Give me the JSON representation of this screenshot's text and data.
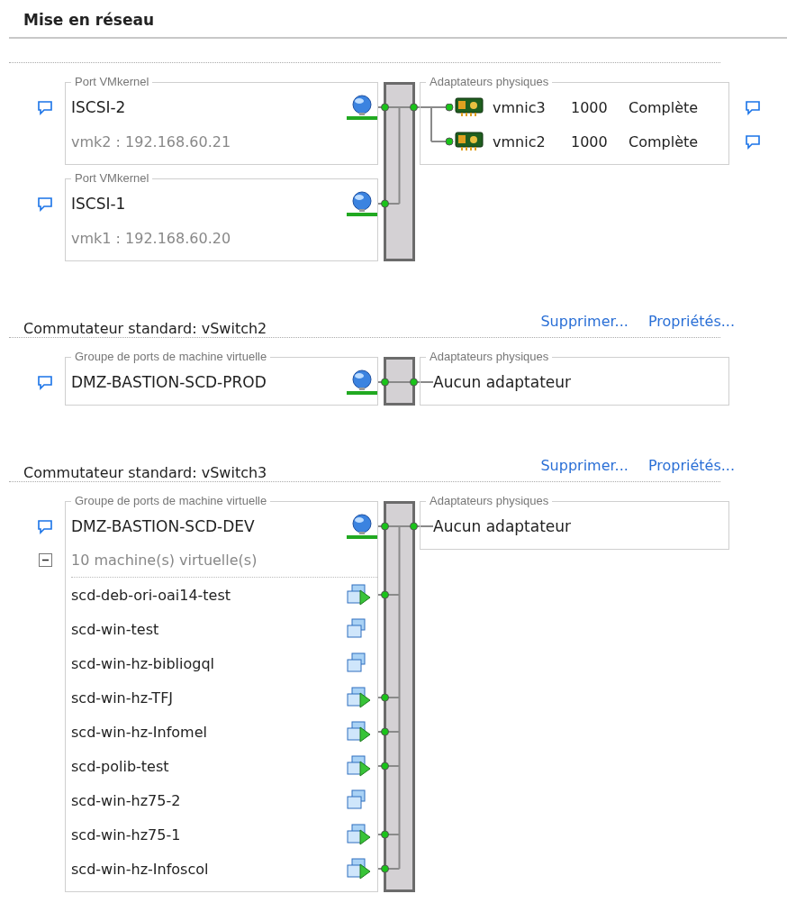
{
  "title": "Mise en réseau",
  "switches": [
    {
      "ports": [
        {
          "kind": "vmkernel",
          "legend": "Port VMkernel",
          "name": "ISCSI-2",
          "detail": "vmk2 : 192.168.60.21"
        },
        {
          "kind": "vmkernel",
          "legend": "Port VMkernel",
          "name": "ISCSI-1",
          "detail": "vmk1 : 192.168.60.20"
        }
      ],
      "adapters_legend": "Adaptateurs physiques",
      "adapters": [
        {
          "name": "vmnic3",
          "speed": "1000",
          "duplex": "Complète"
        },
        {
          "name": "vmnic2",
          "speed": "1000",
          "duplex": "Complète"
        }
      ]
    },
    {
      "title": "Commutateur standard: vSwitch2",
      "actions": [
        "Supprimer...",
        "Propriétés..."
      ],
      "ports": [
        {
          "kind": "vm_group",
          "legend": "Groupe de ports de machine virtuelle",
          "name": "DMZ-BASTION-SCD-PROD"
        }
      ],
      "adapters_legend": "Adaptateurs physiques",
      "no_adapter": "Aucun adaptateur"
    },
    {
      "title": "Commutateur standard: vSwitch3",
      "actions": [
        "Supprimer...",
        "Propriétés..."
      ],
      "ports": [
        {
          "kind": "vm_group",
          "legend": "Groupe de ports de machine virtuelle",
          "name": "DMZ-BASTION-SCD-DEV",
          "vm_count": "10 machine(s) virtuelle(s)",
          "expanded": true,
          "vms": [
            {
              "name": "scd-deb-ori-oai14-test",
              "powered_on": true
            },
            {
              "name": "scd-win-test",
              "powered_on": false
            },
            {
              "name": "scd-win-hz-bibliogql",
              "powered_on": false
            },
            {
              "name": "scd-win-hz-TFJ",
              "powered_on": true
            },
            {
              "name": "scd-win-hz-Infomel",
              "powered_on": true
            },
            {
              "name": "scd-polib-test",
              "powered_on": true
            },
            {
              "name": "scd-win-hz75-2",
              "powered_on": false
            },
            {
              "name": "scd-win-hz75-1",
              "powered_on": true
            },
            {
              "name": "scd-win-hz-Infoscol",
              "powered_on": true
            }
          ]
        }
      ],
      "adapters_legend": "Adaptateurs physiques",
      "no_adapter": "Aucun adaptateur"
    }
  ]
}
